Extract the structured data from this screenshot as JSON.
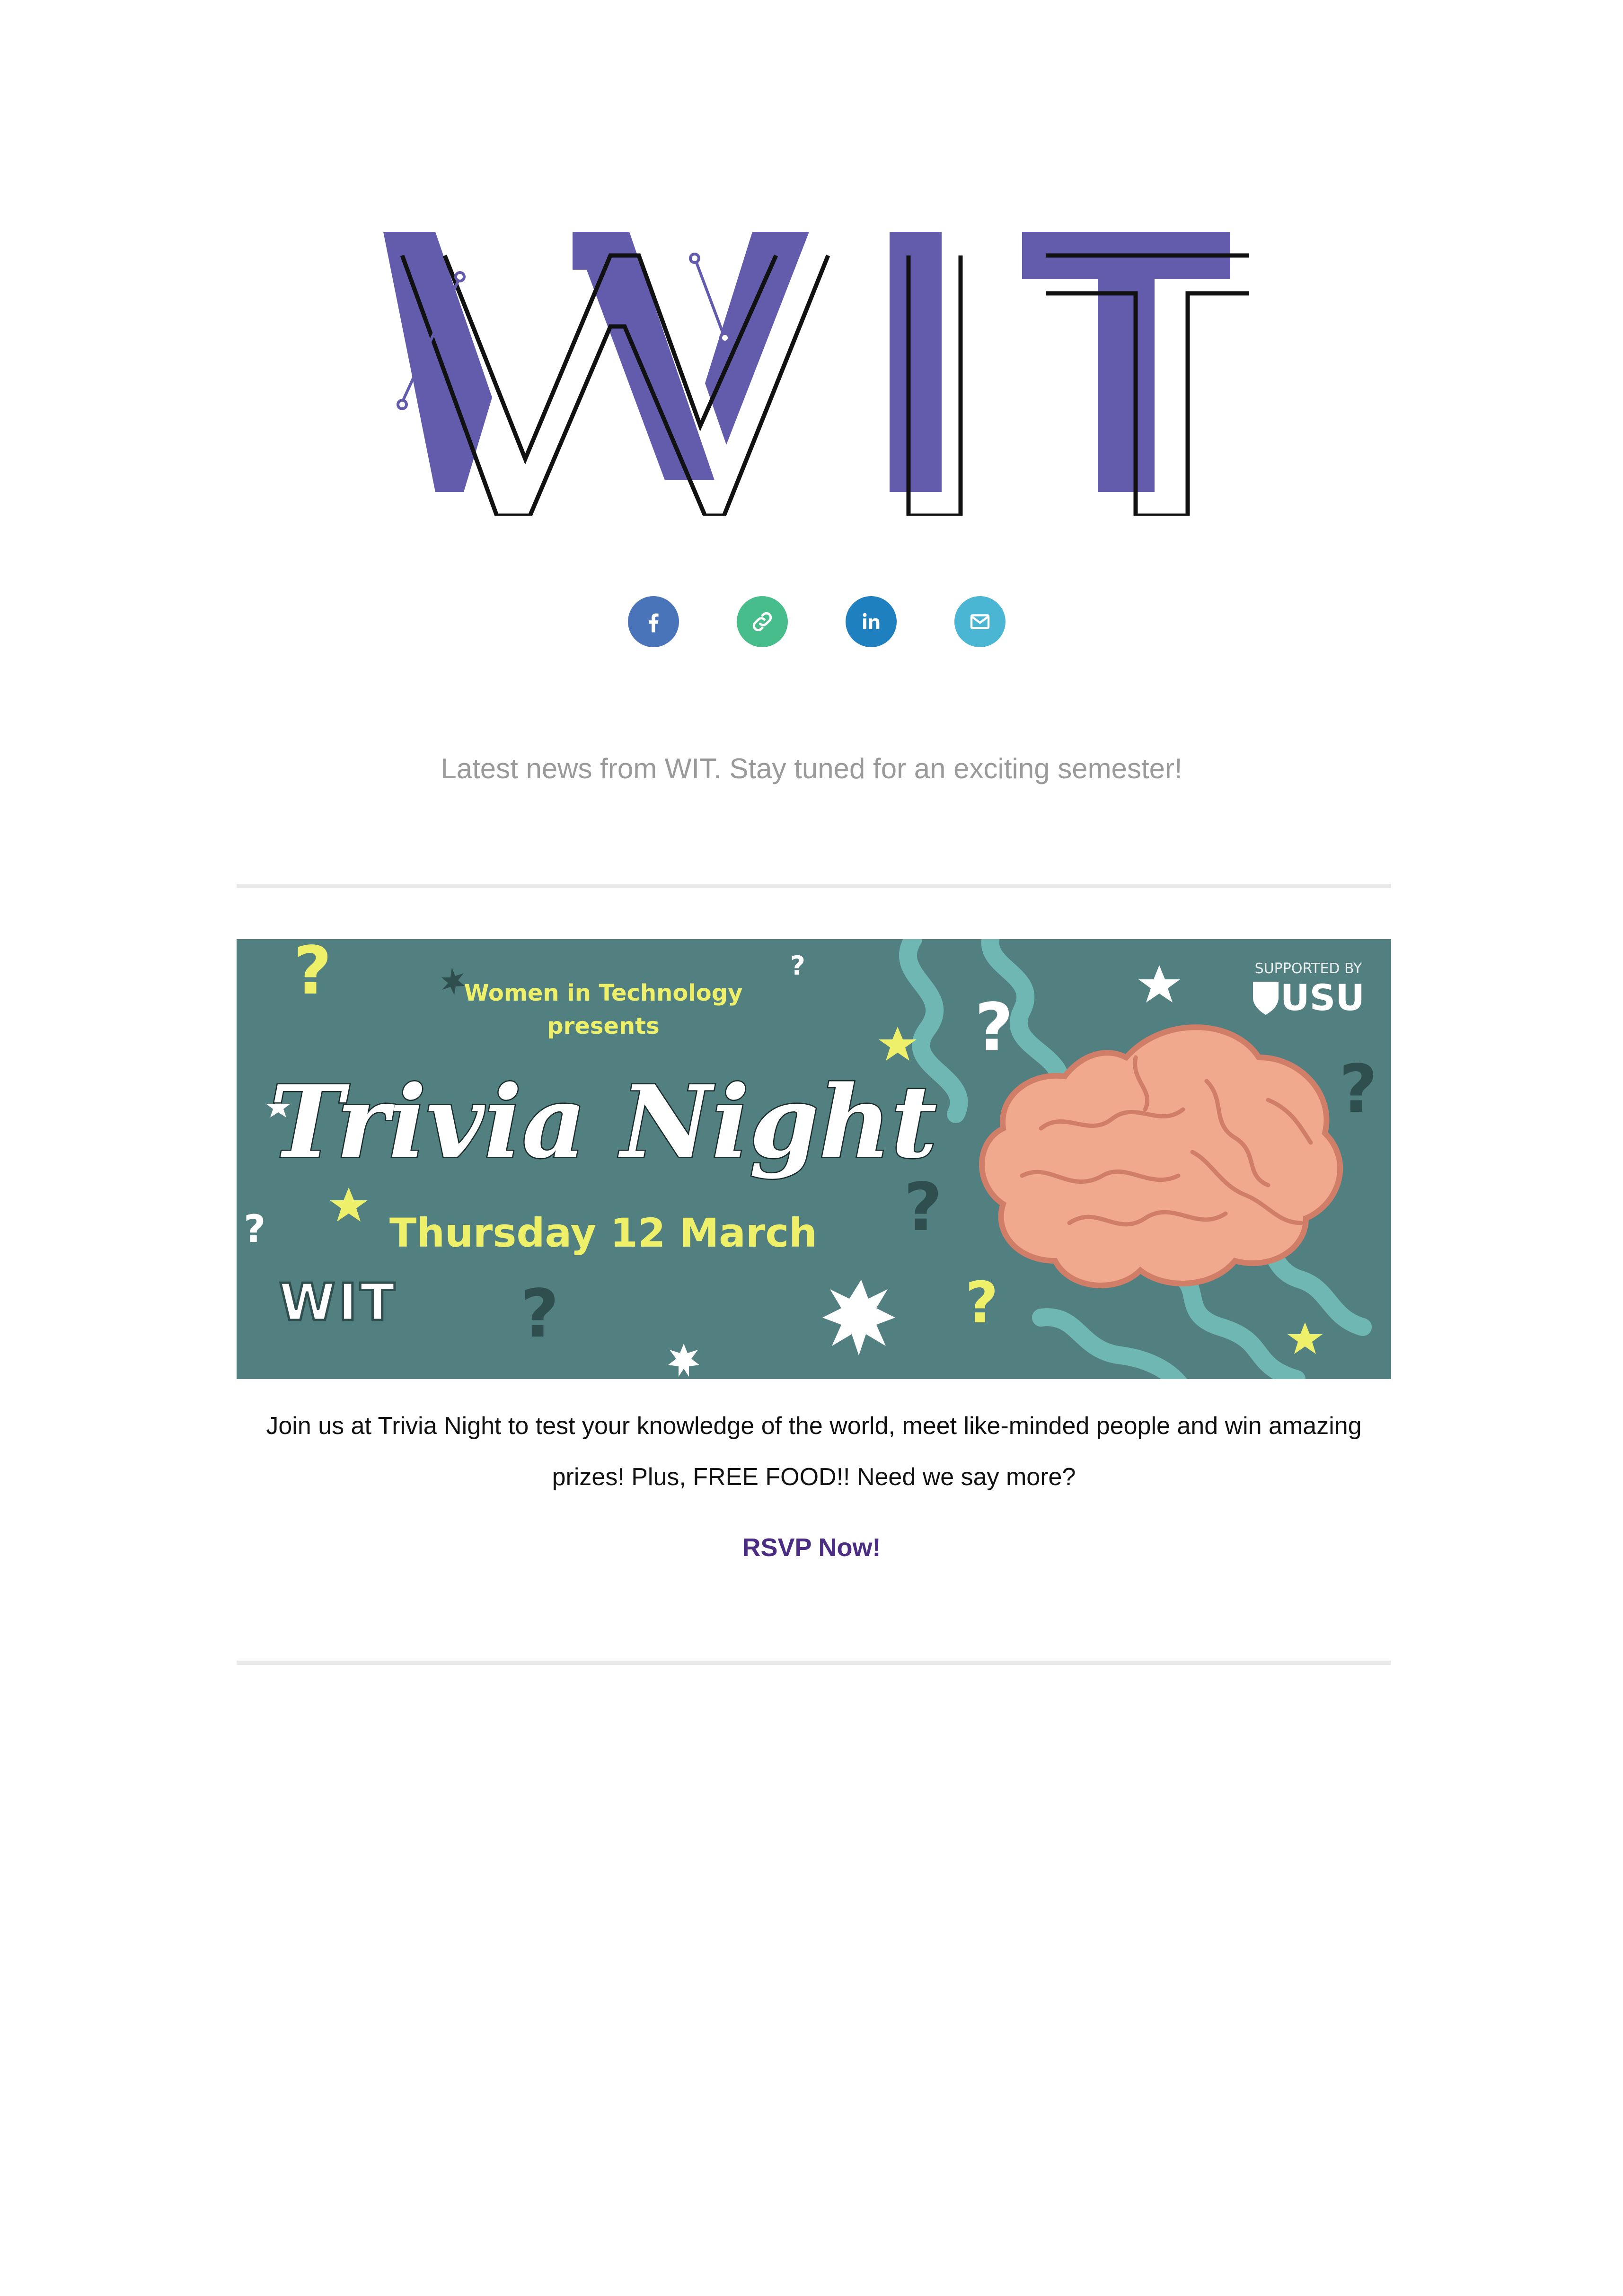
{
  "brand": {
    "logo_text": "WIT",
    "primary_color": "#635bab",
    "outline_color": "#111111"
  },
  "social": [
    {
      "name": "facebook",
      "icon": "facebook-icon",
      "glyph": "f",
      "color": "#4a74b9"
    },
    {
      "name": "link",
      "icon": "link-icon",
      "glyph": "link",
      "color": "#47bd8c"
    },
    {
      "name": "linkedin",
      "icon": "linkedin-icon",
      "glyph": "in",
      "color": "#1f80bf"
    },
    {
      "name": "email",
      "icon": "email-icon",
      "glyph": "mail",
      "color": "#4bb6d3"
    }
  ],
  "tagline": "Latest news from WIT. Stay tuned for an exciting semester!",
  "event": {
    "banner": {
      "presenter": "Women in Technology",
      "presents": "presents",
      "title": "Trivia Night",
      "date": "Thursday 12 March",
      "supported_by": "SUPPORTED BY",
      "sponsor": "USU",
      "footer_logo": "WIT",
      "background_color": "#527f7f",
      "accent_color": "#eef06a",
      "brain_color": "#f0a98c"
    },
    "description": "Join us at Trivia Night to test your knowledge of the world, meet like-minded people and win amazing prizes! Plus, FREE FOOD!! Need we say more?",
    "cta_label": "RSVP Now!"
  }
}
